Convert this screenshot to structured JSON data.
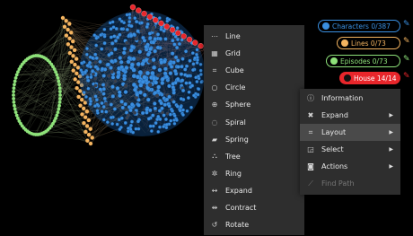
{
  "layout_menu": {
    "items": [
      {
        "icon": "line-icon",
        "glyph": "⋯",
        "label": "Line"
      },
      {
        "icon": "grid-icon",
        "glyph": "▦",
        "label": "Grid"
      },
      {
        "icon": "cube-icon",
        "glyph": "⌗",
        "label": "Cube"
      },
      {
        "icon": "circle-icon",
        "glyph": "○",
        "label": "Circle"
      },
      {
        "icon": "sphere-icon",
        "glyph": "⊕",
        "label": "Sphere"
      },
      {
        "icon": "spiral-icon",
        "glyph": "◌",
        "label": "Spiral"
      },
      {
        "icon": "spring-icon",
        "glyph": "▰",
        "label": "Spring"
      },
      {
        "icon": "tree-icon",
        "glyph": "⛬",
        "label": "Tree"
      },
      {
        "icon": "ring-icon",
        "glyph": "✲",
        "label": "Ring"
      },
      {
        "icon": "expand-icon",
        "glyph": "↔",
        "label": "Expand"
      },
      {
        "icon": "contract-icon",
        "glyph": "⇹",
        "label": "Contract"
      },
      {
        "icon": "rotate-icon",
        "glyph": "↺",
        "label": "Rotate"
      }
    ]
  },
  "context_menu": {
    "items": [
      {
        "icon": "info-icon",
        "glyph": "ⓘ",
        "label": "Information",
        "submenu": false,
        "active": false,
        "disabled": false
      },
      {
        "icon": "expand-arrows-icon",
        "glyph": "✖",
        "label": "Expand",
        "submenu": true,
        "active": false,
        "disabled": false
      },
      {
        "icon": "layout-icon",
        "glyph": "⌗",
        "label": "Layout",
        "submenu": true,
        "active": true,
        "disabled": false
      },
      {
        "icon": "select-icon",
        "glyph": "◲",
        "label": "Select",
        "submenu": true,
        "active": false,
        "disabled": false
      },
      {
        "icon": "actions-icon",
        "glyph": "◙",
        "label": "Actions",
        "submenu": true,
        "active": false,
        "disabled": false
      },
      {
        "icon": "find-path-icon",
        "glyph": "⟋",
        "label": "Find Path",
        "submenu": false,
        "active": false,
        "disabled": true
      }
    ],
    "submenu_glyph": "▶"
  },
  "filters": [
    {
      "label": "Characters 0/387",
      "color": "#3a8fe0",
      "border": "#3a8fe0",
      "bg": "#000000",
      "text": "#3a8fe0",
      "pen": "#3a8fe0"
    },
    {
      "label": "Lines 0/73",
      "color": "#f4b460",
      "border": "#f4b460",
      "bg": "#000000",
      "text": "#f4b460",
      "pen": "#f4b460"
    },
    {
      "label": "Episodes 0/73",
      "color": "#8ee27a",
      "border": "#8ee27a",
      "bg": "#000000",
      "text": "#8ee27a",
      "pen": "#8ee27a"
    },
    {
      "label": "House 14/14",
      "color": "#ffffff",
      "border": "#e8262b",
      "bg": "#e8262b",
      "text": "#ffffff",
      "pen": "#e8262b"
    }
  ],
  "pen_glyph": "✎",
  "colors": {
    "characters": "#3a8fe0",
    "lines": "#f4b460",
    "episodes": "#8ee27a",
    "house": "#e8262b"
  }
}
